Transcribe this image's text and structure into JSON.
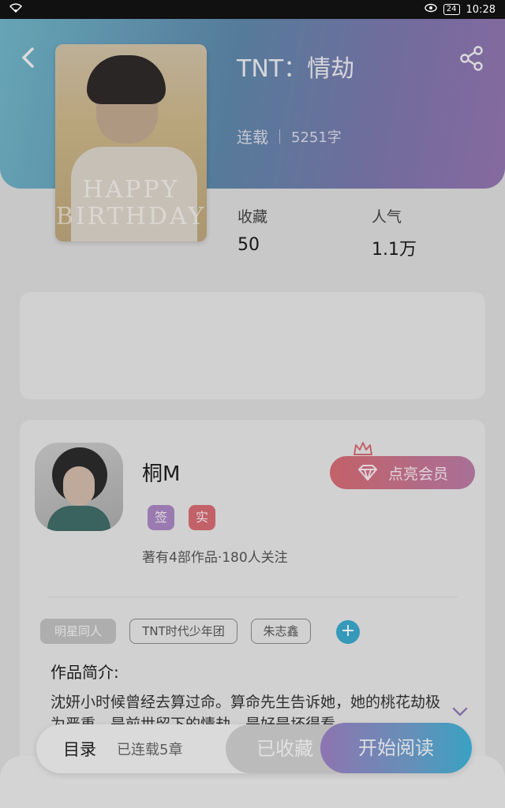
{
  "status_bar": {
    "time": "10:28",
    "battery": "24"
  },
  "book": {
    "title": "TNT：情劫",
    "status": "连载",
    "word_count": "5251字",
    "cover_text": "HAPPY BIRTHDAY"
  },
  "stats": {
    "collect_label": "收藏",
    "collect_value": "50",
    "popularity_label": "人气",
    "popularity_value": "1.1万"
  },
  "author": {
    "name": "桐M",
    "badge_sign": "签",
    "badge_real": "实",
    "info": "著有4部作品·180人关注",
    "vip_button": "点亮会员"
  },
  "tags": [
    "明星同人",
    "TNT时代少年团",
    "朱志鑫"
  ],
  "intro": {
    "title": "作品简介:",
    "text": "沈妍小时候曾经去算过命。算命先生告诉她，她的桃花劫极为严重，是前世留下的情劫，是好是坏得看"
  },
  "bottom_bar": {
    "catalog": "目录",
    "chapters": "已连载5章",
    "collected": "已收藏",
    "read": "开始阅读"
  }
}
